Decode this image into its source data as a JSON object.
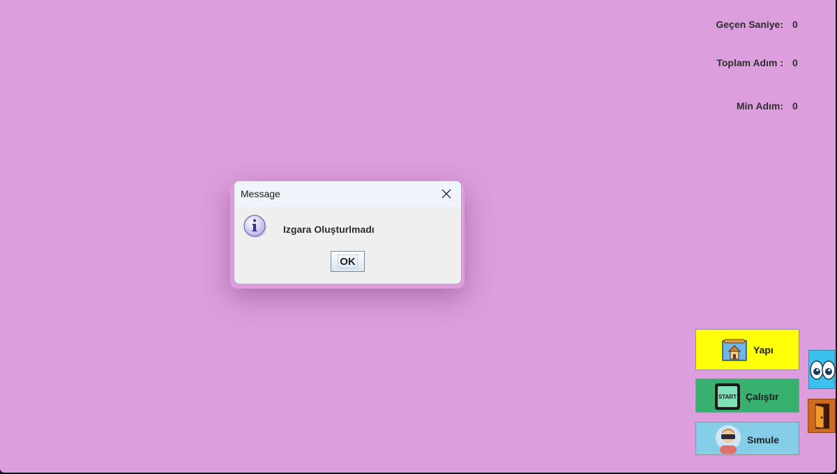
{
  "stats": {
    "elapsed_label": "Geçen Saniye:",
    "elapsed_value": "0",
    "total_steps_label": "Toplam Adım :",
    "total_steps_value": "0",
    "min_steps_label": "Min Adım:",
    "min_steps_value": "0"
  },
  "buttons": {
    "build": {
      "label": "Yapı",
      "color": "#ffff0a",
      "icon": "house-blueprint-icon"
    },
    "run": {
      "label": "Çalıştır",
      "color": "#38b070",
      "icon": "start-icon",
      "icon_text": "START"
    },
    "simulate": {
      "label": "Sımule",
      "color": "#86cde8",
      "icon": "vr-headset-person-icon"
    },
    "eyes": {
      "icon": "eyes-icon",
      "color": "#3cc0ee"
    },
    "exit": {
      "icon": "door-icon",
      "color": "#d06a1e"
    }
  },
  "dialog": {
    "title": "Message",
    "message": "Izgara Oluşturlmadı",
    "ok_label": "OK",
    "icon": "info-icon"
  }
}
